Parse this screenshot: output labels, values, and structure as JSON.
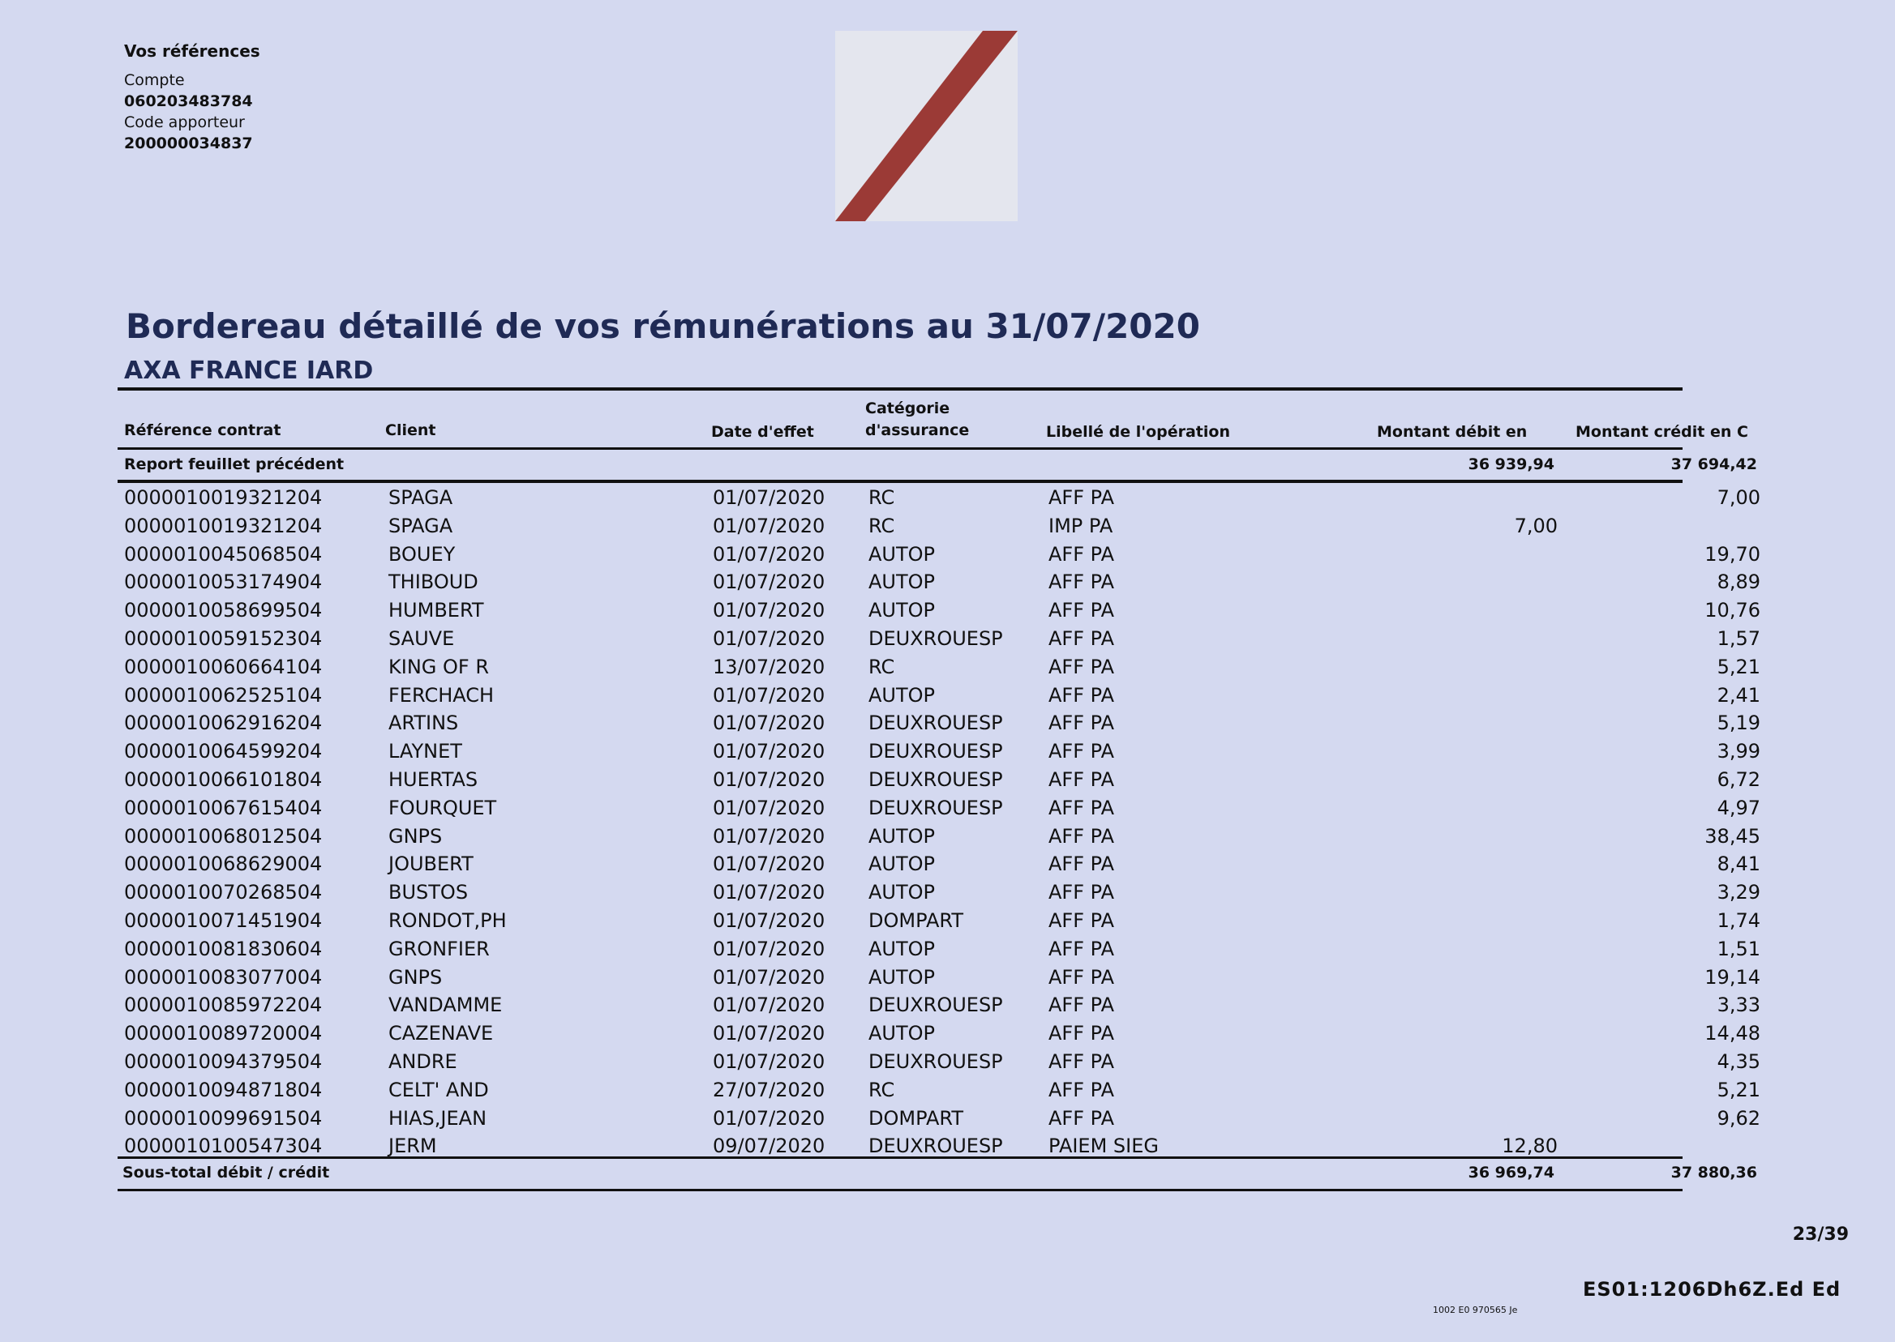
{
  "refs": {
    "heading": "Vos références",
    "account_label": "Compte",
    "account_value": "060203483784",
    "provider_label": "Code apporteur",
    "provider_value": "200000034837"
  },
  "title": "Bordereau détaillé de vos rémunérations au 31/07/2020",
  "company": "AXA FRANCE IARD",
  "headers": {
    "ref": "Référence contrat",
    "client": "Client",
    "date": "Date d'effet",
    "cat1": "Catégorie",
    "cat2": "d'assurance",
    "libelle": "Libellé de l'opération",
    "debit": "Montant débit en",
    "credit": "Montant crédit en C"
  },
  "carry": {
    "label": "Report feuillet précédent",
    "debit": "36 939,94",
    "credit": "37 694,42"
  },
  "rows": [
    {
      "ref": "0000010019321204",
      "client": "SPAGA",
      "date": "01/07/2020",
      "cat": "RC",
      "lib": "AFF PA",
      "debit": "",
      "credit": "7,00"
    },
    {
      "ref": "0000010019321204",
      "client": "SPAGA",
      "date": "01/07/2020",
      "cat": "RC",
      "lib": "IMP PA",
      "debit": "7,00",
      "credit": ""
    },
    {
      "ref": "0000010045068504",
      "client": "BOUEY",
      "date": "01/07/2020",
      "cat": "AUTOP",
      "lib": "AFF PA",
      "debit": "",
      "credit": "19,70"
    },
    {
      "ref": "0000010053174904",
      "client": "THIBOUD",
      "date": "01/07/2020",
      "cat": "AUTOP",
      "lib": "AFF PA",
      "debit": "",
      "credit": "8,89"
    },
    {
      "ref": "0000010058699504",
      "client": "HUMBERT",
      "date": "01/07/2020",
      "cat": "AUTOP",
      "lib": "AFF PA",
      "debit": "",
      "credit": "10,76"
    },
    {
      "ref": "0000010059152304",
      "client": "SAUVE",
      "date": "01/07/2020",
      "cat": "DEUXROUESP",
      "lib": "AFF PA",
      "debit": "",
      "credit": "1,57"
    },
    {
      "ref": "0000010060664104",
      "client": "KING OF R",
      "date": "13/07/2020",
      "cat": "RC",
      "lib": "AFF PA",
      "debit": "",
      "credit": "5,21"
    },
    {
      "ref": "0000010062525104",
      "client": "FERCHACH",
      "date": "01/07/2020",
      "cat": "AUTOP",
      "lib": "AFF PA",
      "debit": "",
      "credit": "2,41"
    },
    {
      "ref": "0000010062916204",
      "client": "ARTINS",
      "date": "01/07/2020",
      "cat": "DEUXROUESP",
      "lib": "AFF PA",
      "debit": "",
      "credit": "5,19"
    },
    {
      "ref": "0000010064599204",
      "client": "LAYNET",
      "date": "01/07/2020",
      "cat": "DEUXROUESP",
      "lib": "AFF PA",
      "debit": "",
      "credit": "3,99"
    },
    {
      "ref": "0000010066101804",
      "client": "HUERTAS",
      "date": "01/07/2020",
      "cat": "DEUXROUESP",
      "lib": "AFF PA",
      "debit": "",
      "credit": "6,72"
    },
    {
      "ref": "0000010067615404",
      "client": "FOURQUET",
      "date": "01/07/2020",
      "cat": "DEUXROUESP",
      "lib": "AFF PA",
      "debit": "",
      "credit": "4,97"
    },
    {
      "ref": "0000010068012504",
      "client": "GNPS",
      "date": "01/07/2020",
      "cat": "AUTOP",
      "lib": "AFF PA",
      "debit": "",
      "credit": "38,45"
    },
    {
      "ref": "0000010068629004",
      "client": "JOUBERT",
      "date": "01/07/2020",
      "cat": "AUTOP",
      "lib": "AFF PA",
      "debit": "",
      "credit": "8,41"
    },
    {
      "ref": "0000010070268504",
      "client": "BUSTOS",
      "date": "01/07/2020",
      "cat": "AUTOP",
      "lib": "AFF PA",
      "debit": "",
      "credit": "3,29"
    },
    {
      "ref": "0000010071451904",
      "client": "RONDOT,PH",
      "date": "01/07/2020",
      "cat": "DOMPART",
      "lib": "AFF PA",
      "debit": "",
      "credit": "1,74"
    },
    {
      "ref": "0000010081830604",
      "client": "GRONFIER",
      "date": "01/07/2020",
      "cat": "AUTOP",
      "lib": "AFF PA",
      "debit": "",
      "credit": "1,51"
    },
    {
      "ref": "0000010083077004",
      "client": "GNPS",
      "date": "01/07/2020",
      "cat": "AUTOP",
      "lib": "AFF PA",
      "debit": "",
      "credit": "19,14"
    },
    {
      "ref": "0000010085972204",
      "client": "VANDAMME",
      "date": "01/07/2020",
      "cat": "DEUXROUESP",
      "lib": "AFF PA",
      "debit": "",
      "credit": "3,33"
    },
    {
      "ref": "0000010089720004",
      "client": "CAZENAVE",
      "date": "01/07/2020",
      "cat": "AUTOP",
      "lib": "AFF PA",
      "debit": "",
      "credit": "14,48"
    },
    {
      "ref": "0000010094379504",
      "client": "ANDRE",
      "date": "01/07/2020",
      "cat": "DEUXROUESP",
      "lib": "AFF PA",
      "debit": "",
      "credit": "4,35"
    },
    {
      "ref": "0000010094871804",
      "client": "CELT' AND",
      "date": "27/07/2020",
      "cat": "RC",
      "lib": "AFF PA",
      "debit": "",
      "credit": "5,21"
    },
    {
      "ref": "0000010099691504",
      "client": "HIAS,JEAN",
      "date": "01/07/2020",
      "cat": "DOMPART",
      "lib": "AFF PA",
      "debit": "",
      "credit": "9,62"
    },
    {
      "ref": "0000010100547304",
      "client": "JERM",
      "date": "09/07/2020",
      "cat": "DEUXROUESP",
      "lib": "PAIEM SIEG",
      "debit": "12,80",
      "credit": ""
    }
  ],
  "subtotal": {
    "label": "Sous-total débit / crédit",
    "debit": "36 969,74",
    "credit": "37 880,36"
  },
  "page_number": "23/39",
  "doc_code": "ES01:1206Dh6Z.Ed Ed",
  "tiny_code": "1002 E0 970565  Je",
  "logo_colors": {
    "bar": "#9b3a36"
  }
}
